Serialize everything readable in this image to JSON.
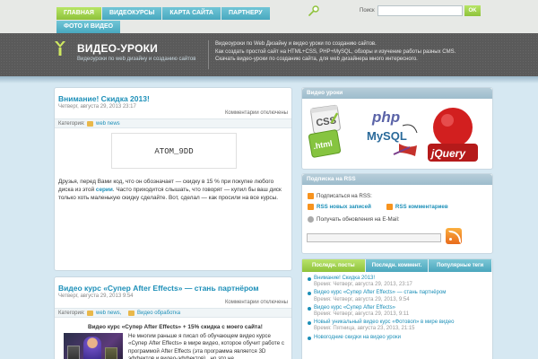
{
  "nav": {
    "items": [
      {
        "label": "ГЛАВНАЯ",
        "active": true
      },
      {
        "label": "ВИДЕОКУРСЫ",
        "active": false
      },
      {
        "label": "КАРТА САЙТА",
        "active": false
      },
      {
        "label": "ПАРТНЕРУ",
        "active": false
      },
      {
        "label": "ФОТО И ВИДЕО",
        "active": false
      }
    ]
  },
  "search": {
    "label": "Поиск",
    "placeholder": "",
    "button": "OK"
  },
  "header": {
    "title": "ВИДЕО-УРОКИ",
    "tagline": "Видеоуроки по web дизайну и созданию сайтов",
    "desc_lines": [
      "Видеоуроки по Web Дизайну и видео уроки по созданию сайтов.",
      "Как создать простой сайт на HTML+CSS, PHP+MySQL, обзоры и изучение работы разных CMS.",
      "Скачать видео-уроки по созданию сайта, для web дизайнера много интересного."
    ]
  },
  "post1": {
    "title": "Внимание! Скидка 2013!",
    "date": "Четверг, августа 29, 2013 23:17",
    "comments": "Комментарии отключены",
    "cat_label": "Категория:",
    "category": "web news",
    "atom": "ATOM_9DD",
    "text_before": "Друзья, перед Вами код, что он обозначает — скидку в 15 % при покупке любого диска из этой ",
    "text_link": "серии",
    "text_after": ". Часто приходится слышать, что говорят — купил бы ваш диск только хоть маленькую скидку сделайте. Вот, сделал — как просили на все курсы."
  },
  "post2": {
    "title": "Видео курс «Супер After Effects» — стань партнёром",
    "date": "Четверг, августа 29, 2013 9:54",
    "comments": "Комментарии отключены",
    "cat_label": "Категория:",
    "category": "web news,",
    "category2": "Видео обработка",
    "bold": "Видео курс «Супер After Effects» + 15% скидка с моего сайта!",
    "text": "Не многим раньше я писал об обучающем видео курсе «Супер After Effects» в мире видео, которое обучит работе с программой After Effects (эта программа является 3D эффектов и видео-эффектов) , но это не"
  },
  "widgets": {
    "video_title": "Видео уроки",
    "rss_title": "Подписка на RSS",
    "rss_subscribe": "Подписаться на RSS:",
    "rss_posts": "RSS новых записей",
    "rss_comments": "RSS комментариев",
    "rss_email": "Получать обновления на E-Mail:"
  },
  "tabs": {
    "labels": [
      "Последн. посты",
      "Последн. коммент.",
      "Популярные теги"
    ],
    "items": [
      {
        "title": "Внимание! Скидка 2013!",
        "date": "Время: Четверг, августа 29, 2013, 23:17"
      },
      {
        "title": "Видео курс «Супер After Effects» — стань партнёром",
        "date": "Время: Четверг, августа 29, 2013, 9:54"
      },
      {
        "title": "Видео курс «Супер After Effects»",
        "date": "Время: Четверг, августа 29, 2013, 9:11"
      },
      {
        "title": "Новый уникальный видео курс «Фотовоп» в мире видео",
        "date": "Время: Пятница, августа 23, 2013, 21:15"
      },
      {
        "title": "Новогодние скидки на видео уроки",
        "date": ""
      }
    ]
  },
  "colors": {
    "accent_green": "#8ec23a",
    "accent_blue": "#1c8fb8",
    "header_bg": "#5a5a5a"
  }
}
